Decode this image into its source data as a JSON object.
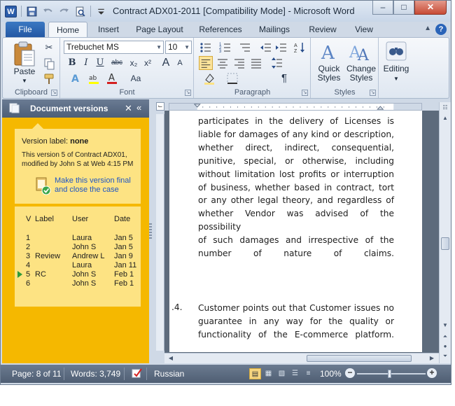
{
  "window": {
    "title": "Contract ADX01-2011 [Compatibility Mode]  -  Microsoft Word",
    "app_icon": "W"
  },
  "tabs": [
    "File",
    "Home",
    "Insert",
    "Page Layout",
    "References",
    "Mailings",
    "Review",
    "View"
  ],
  "active_tab": "Home",
  "ribbon": {
    "clipboard": {
      "label": "Clipboard",
      "paste": "Paste"
    },
    "font": {
      "label": "Font",
      "family": "Trebuchet MS",
      "size": "10",
      "bold": "B",
      "italic": "I",
      "underline": "U",
      "strike": "abc",
      "subscript": "x₂",
      "superscript": "x²",
      "grow": "A",
      "shrink": "A",
      "case": "Aa"
    },
    "paragraph": {
      "label": "Paragraph"
    },
    "styles": {
      "label": "Styles",
      "quick": "Quick Styles",
      "change": "Change Styles"
    },
    "editing": {
      "label": "Editing"
    }
  },
  "pane": {
    "title": "Document versions",
    "version_label_prefix": "Version label:",
    "version_label_value": "none",
    "version_desc": "This version 5 of Contract ADX01, modified by John S at Web 4:15 PM",
    "make_final": "Make this version final and close the case",
    "columns": [
      "V",
      "Label",
      "User",
      "Date"
    ],
    "versions": [
      {
        "v": "1",
        "label": "",
        "user": "Laura",
        "date": "Jan 5"
      },
      {
        "v": "2",
        "label": "",
        "user": "John S",
        "date": "Jan 5"
      },
      {
        "v": "3",
        "label": "Review",
        "user": "Andrew L",
        "date": "Jan 9"
      },
      {
        "v": "4",
        "label": "",
        "user": "Laura",
        "date": "Jan 11"
      },
      {
        "v": "5",
        "label": "RC",
        "user": "John S",
        "date": "Feb 1"
      },
      {
        "v": "6",
        "label": "",
        "user": "John S",
        "date": "Feb 1"
      }
    ],
    "current_version": "5",
    "accent": "#f5b800"
  },
  "document": {
    "para1_lines": [
      "participates in the delivery of Licenses is",
      "liable for damages of any kind or description,",
      "whether direct, indirect, consequential,",
      "punitive, special, or otherwise, including",
      "without limitation lost profits or interruption",
      "of business, whether based in contract, tort",
      "or any other legal theory, and regardless of",
      "whether Vendor was advised of the possibility",
      "of such damages and irrespective of the",
      "number of nature of claims."
    ],
    "item4_number": ".4.",
    "para2_lines": [
      "Customer points out that Customer issues no",
      "guarantee in any way for the quality or",
      "functionality of the E-commerce platform."
    ]
  },
  "status": {
    "page": "Page: 8 of 11",
    "words": "Words: 3,749",
    "language": "Russian",
    "zoom": "100%"
  }
}
